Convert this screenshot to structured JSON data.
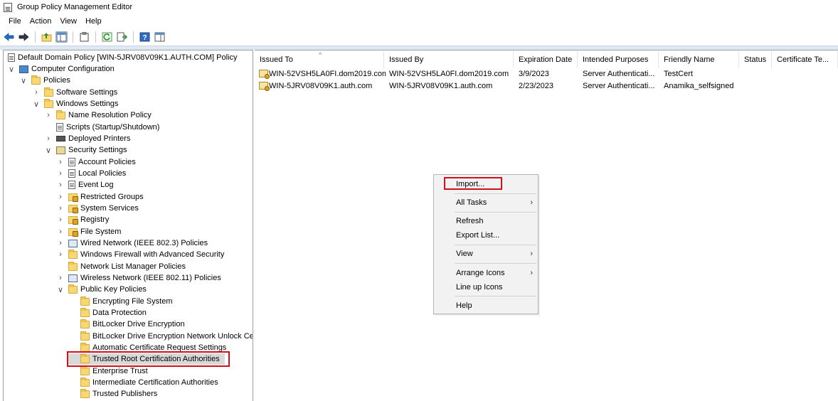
{
  "window": {
    "title": "Group Policy Management Editor",
    "icon": "gpo-editor-icon"
  },
  "menubar": {
    "items": [
      "File",
      "Action",
      "View",
      "Help"
    ]
  },
  "toolbar": {
    "icons": [
      "back-arrow-icon",
      "forward-arrow-icon",
      "up-folder-icon",
      "show-hide-tree-icon",
      "clipboard-icon",
      "refresh-icon",
      "export-list-icon",
      "help-icon",
      "action-pane-icon"
    ]
  },
  "tree": {
    "items": [
      {
        "label": "Default Domain Policy [WIN-5JRV08V09K1.AUTH.COM] Policy",
        "expander": "",
        "icon": "policy-document-icon"
      },
      {
        "label": "Computer Configuration",
        "expander": "∨",
        "icon": "computer-icon"
      },
      {
        "label": "Policies",
        "expander": "∨",
        "icon": "folder-icon"
      },
      {
        "label": "Software Settings",
        "expander": "›",
        "icon": "folder-icon"
      },
      {
        "label": "Windows Settings",
        "expander": "∨",
        "icon": "folder-icon"
      },
      {
        "label": "Name Resolution Policy",
        "expander": "›",
        "icon": "folder-icon"
      },
      {
        "label": "Scripts (Startup/Shutdown)",
        "expander": "",
        "icon": "script-document-icon"
      },
      {
        "label": "Deployed Printers",
        "expander": "›",
        "icon": "printer-icon"
      },
      {
        "label": "Security Settings",
        "expander": "∨",
        "icon": "security-settings-icon"
      },
      {
        "label": "Account Policies",
        "expander": "›",
        "icon": "policy-document-icon"
      },
      {
        "label": "Local Policies",
        "expander": "›",
        "icon": "policy-document-icon"
      },
      {
        "label": "Event Log",
        "expander": "›",
        "icon": "policy-document-icon"
      },
      {
        "label": "Restricted Groups",
        "expander": "›",
        "icon": "locked-folder-icon"
      },
      {
        "label": "System Services",
        "expander": "›",
        "icon": "locked-folder-icon"
      },
      {
        "label": "Registry",
        "expander": "›",
        "icon": "locked-folder-icon"
      },
      {
        "label": "File System",
        "expander": "›",
        "icon": "locked-folder-icon"
      },
      {
        "label": "Wired Network (IEEE 802.3) Policies",
        "expander": "›",
        "icon": "network-policy-icon"
      },
      {
        "label": "Windows Firewall with Advanced Security",
        "expander": "›",
        "icon": "folder-icon"
      },
      {
        "label": "Network List Manager Policies",
        "expander": "",
        "icon": "folder-icon"
      },
      {
        "label": "Wireless Network (IEEE 802.11) Policies",
        "expander": "›",
        "icon": "network-policy-icon"
      },
      {
        "label": "Public Key Policies",
        "expander": "∨",
        "icon": "folder-icon"
      },
      {
        "label": "Encrypting File System",
        "expander": "",
        "icon": "folder-icon"
      },
      {
        "label": "Data Protection",
        "expander": "",
        "icon": "folder-icon"
      },
      {
        "label": "BitLocker Drive Encryption",
        "expander": "",
        "icon": "folder-icon"
      },
      {
        "label": "BitLocker Drive Encryption Network Unlock Ce",
        "expander": "",
        "icon": "folder-icon"
      },
      {
        "label": "Automatic Certificate Request Settings",
        "expander": "",
        "icon": "folder-icon"
      },
      {
        "label": "Trusted Root Certification Authorities",
        "expander": "",
        "icon": "folder-icon",
        "selected": true
      },
      {
        "label": "Enterprise Trust",
        "expander": "",
        "icon": "folder-icon"
      },
      {
        "label": "Intermediate Certification Authorities",
        "expander": "",
        "icon": "folder-icon"
      },
      {
        "label": "Trusted Publishers",
        "expander": "",
        "icon": "folder-icon"
      }
    ]
  },
  "list": {
    "columns": [
      "Issued To",
      "Issued By",
      "Expiration Date",
      "Intended Purposes",
      "Friendly Name",
      "Status",
      "Certificate Te..."
    ],
    "sort_indicator": "^",
    "rows": [
      [
        "WIN-52VSH5LA0FI.dom2019.com",
        "WIN-52VSH5LA0FI.dom2019.com",
        "3/9/2023",
        "Server Authenticati...",
        "TestCert",
        "",
        ""
      ],
      [
        "WIN-5JRV08V09K1.auth.com",
        "WIN-5JRV08V09K1.auth.com",
        "2/23/2023",
        "Server Authenticati...",
        "Anamika_selfsigned",
        "",
        ""
      ]
    ]
  },
  "context_menu": {
    "items": [
      {
        "label": "Import...",
        "submenu": false
      },
      {
        "label": "All Tasks",
        "submenu": true
      },
      {
        "label": "Refresh",
        "submenu": false
      },
      {
        "label": "Export List...",
        "submenu": false
      },
      {
        "label": "View",
        "submenu": true
      },
      {
        "label": "Arrange Icons",
        "submenu": true
      },
      {
        "label": "Line up Icons",
        "submenu": false
      },
      {
        "label": "Help",
        "submenu": false
      }
    ],
    "submenu_arrow": "›"
  },
  "colors": {
    "highlight_box": "#d0101b",
    "selection_bg": "#d9d9d9",
    "folder": "#f8d775"
  }
}
